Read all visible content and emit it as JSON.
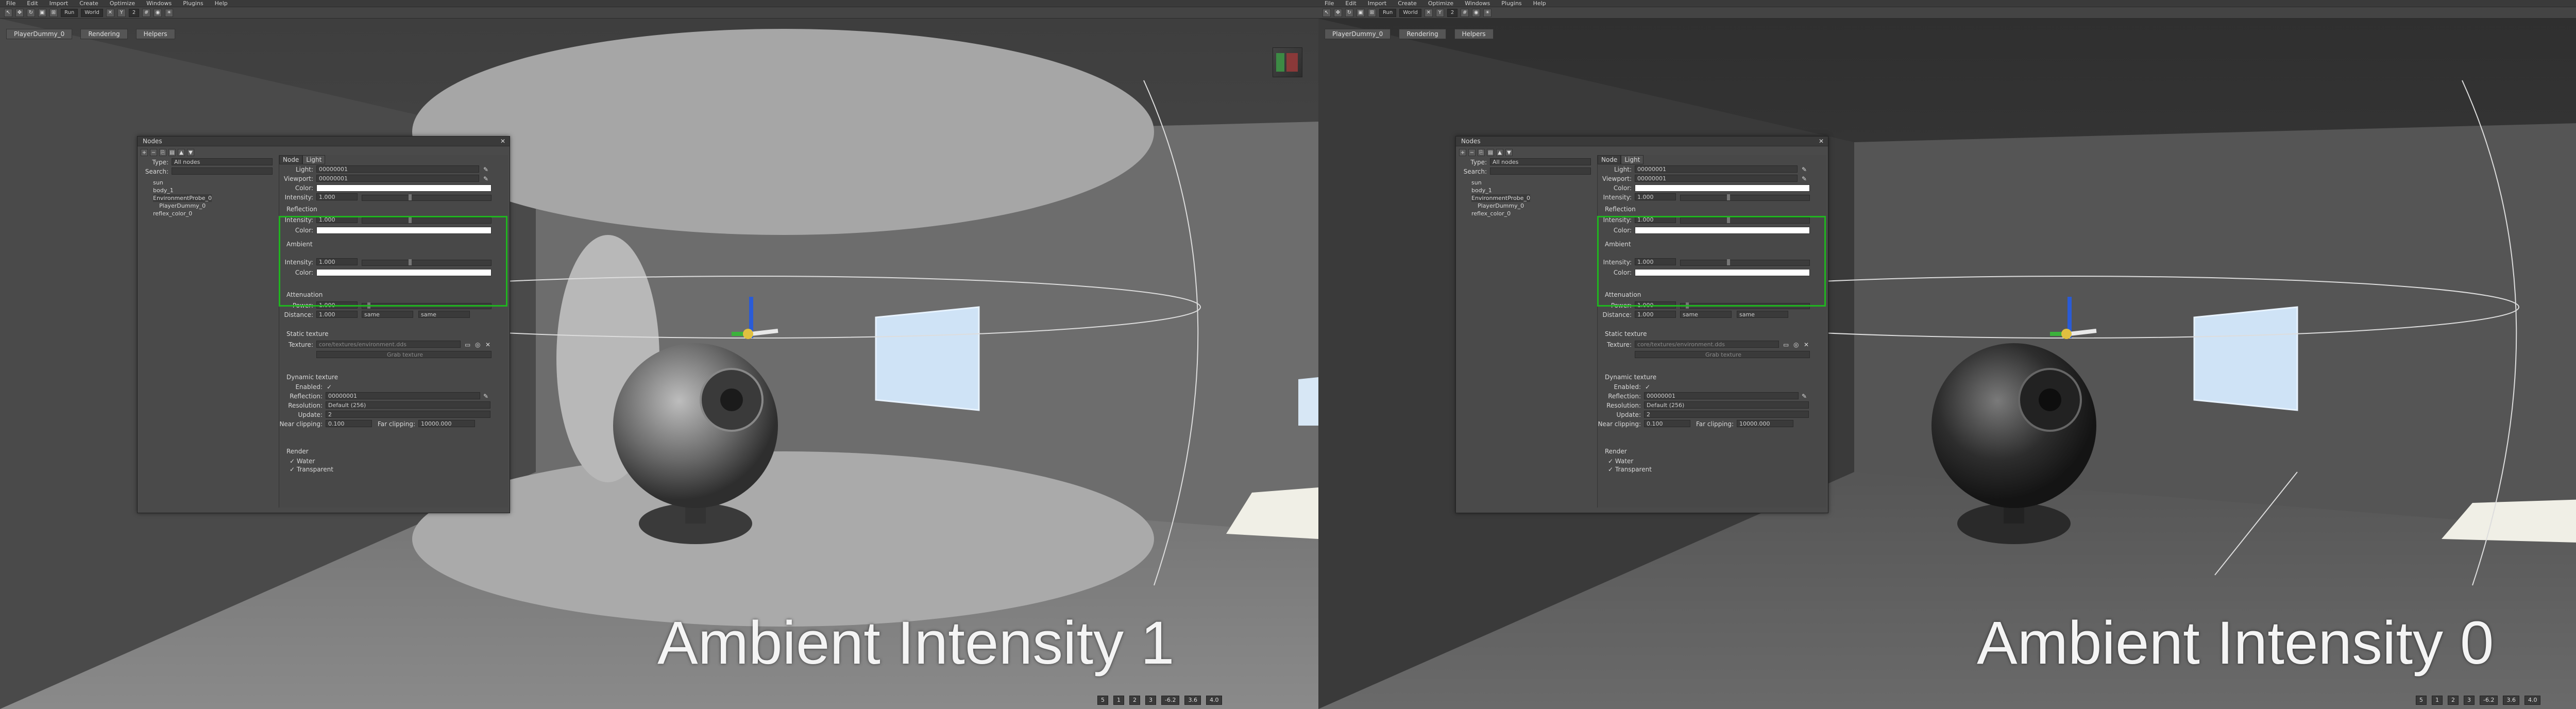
{
  "menu": [
    "File",
    "Edit",
    "Import",
    "Create",
    "Optimize",
    "Windows",
    "Plugins",
    "Help"
  ],
  "toolbar": {
    "run_label": "Run",
    "mode_label": "World",
    "count": "2"
  },
  "tabs": {
    "active": "PlayerDummy_0",
    "rendering": "Rendering",
    "helpers": "Helpers"
  },
  "panel": {
    "title": "Nodes",
    "type_label": "Type:",
    "type_value": "All nodes",
    "search_label": "Search:",
    "tree": [
      "sun",
      "body_1",
      "EnvironmentProbe_0",
      "PlayerDummy_0",
      "reflex_color_0"
    ],
    "tab_node": "Node",
    "tab_light": "Light",
    "light_label": "Light:",
    "light_value": "00000001",
    "viewport_label": "Viewport:",
    "viewport_value": "00000001",
    "color_label": "Color:",
    "intensity_label": "Intensity:",
    "intensity_value": "1.000",
    "reflection_section": "Reflection",
    "refl_intensity_label": "Intensity:",
    "refl_intensity_value": "1.000",
    "refl_color_label": "Color:",
    "ambient_section": "Ambient",
    "amb_intensity_label": "Intensity:",
    "amb_intensity_value": "1.000",
    "amb_color_label": "Color:",
    "attenuation_section": "Attenuation",
    "power_label": "Power:",
    "power_value": "1.000",
    "distance_label": "Distance:",
    "distance_value": "1.000",
    "distance_same1": "same",
    "distance_same2": "same",
    "static_section": "Static texture",
    "texture_label": "Texture:",
    "texture_value": "core/textures/environment.dds",
    "grab_label": "Grab texture",
    "dynamic_section": "Dynamic texture",
    "enabled_label": "Enabled:",
    "reflection_label": "Reflection:",
    "reflection_value": "00000001",
    "resolution_label": "Resolution:",
    "resolution_value": "Default (256)",
    "update_label": "Update:",
    "update_value": "2",
    "near_label": "Near clipping:",
    "near_value": "0.100",
    "far_label": "Far clipping:",
    "far_value": "10000.000",
    "render_section": "Render",
    "water_label": "Water",
    "transparent_label": "Transparent"
  },
  "captions": {
    "left": "Ambient Intensity 1",
    "right": "Ambient Intensity 0"
  },
  "status": {
    "fps": "5",
    "x": "-6.2",
    "y": "3.6",
    "z": "4.0"
  }
}
